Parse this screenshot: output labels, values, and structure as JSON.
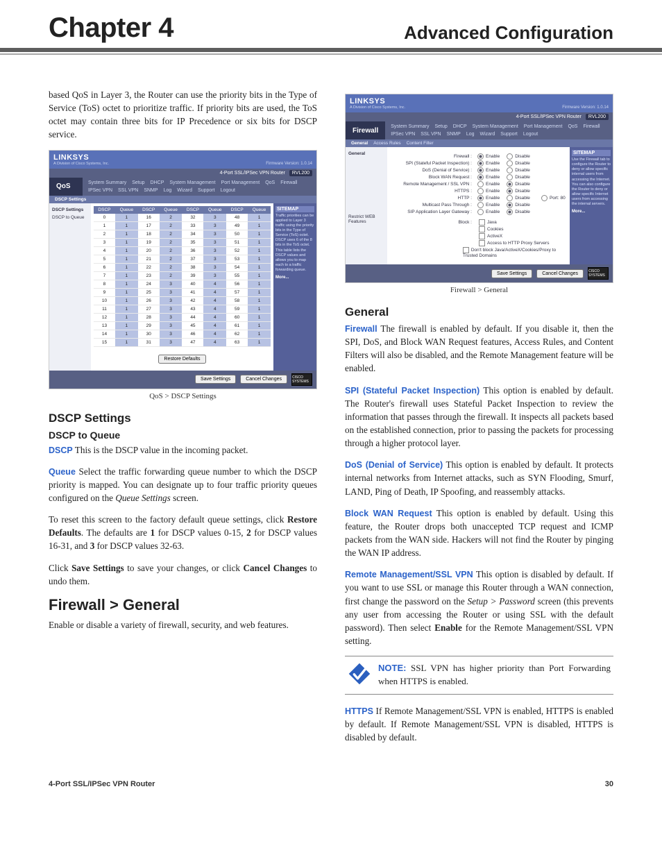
{
  "header": {
    "chapter": "Chapter 4",
    "right": "Advanced Configuration"
  },
  "col1": {
    "intro": "based QoS in Layer 3, the Router can use the priority bits in the Type of Service (ToS) octet to prioritize traffic. If priority bits are used, the ToS octet may contain three bits for IP Precedence or six bits for DSCP service.",
    "qos_ss": {
      "brand": "LINKSYS",
      "brand_sub": "A Division of Cisco Systems, Inc.",
      "fw": "Firmware Version: 1.0.14",
      "model_bar": "4-Port SSL/IPSec VPN Router",
      "model": "RVL200",
      "navlabel": "QoS",
      "navitems": [
        "System Summary",
        "Setup",
        "DHCP",
        "System Management",
        "Port Management",
        "QoS",
        "Firewall",
        "IPSec VPN",
        "SSL VPN",
        "SNMP",
        "Log",
        "Wizard",
        "Support",
        "Logout"
      ],
      "subnav_active": "DSCP Settings",
      "left_items": [
        "DSCP Settings",
        "DSCP to Queue"
      ],
      "table_headers": [
        "DSCP",
        "Queue",
        "DSCP",
        "Queue",
        "DSCP",
        "Queue",
        "DSCP",
        "Queue"
      ],
      "table_rows": [
        [
          "0",
          "1",
          "16",
          "2",
          "32",
          "3",
          "48",
          "1"
        ],
        [
          "1",
          "1",
          "17",
          "2",
          "33",
          "3",
          "49",
          "1"
        ],
        [
          "2",
          "1",
          "18",
          "2",
          "34",
          "3",
          "50",
          "1"
        ],
        [
          "3",
          "1",
          "19",
          "2",
          "35",
          "3",
          "51",
          "1"
        ],
        [
          "4",
          "1",
          "20",
          "2",
          "36",
          "3",
          "52",
          "1"
        ],
        [
          "5",
          "1",
          "21",
          "2",
          "37",
          "3",
          "53",
          "1"
        ],
        [
          "6",
          "1",
          "22",
          "2",
          "38",
          "3",
          "54",
          "1"
        ],
        [
          "7",
          "1",
          "23",
          "2",
          "39",
          "3",
          "55",
          "1"
        ],
        [
          "8",
          "1",
          "24",
          "3",
          "40",
          "4",
          "56",
          "1"
        ],
        [
          "9",
          "1",
          "25",
          "3",
          "41",
          "4",
          "57",
          "1"
        ],
        [
          "10",
          "1",
          "26",
          "3",
          "42",
          "4",
          "58",
          "1"
        ],
        [
          "11",
          "1",
          "27",
          "3",
          "43",
          "4",
          "59",
          "1"
        ],
        [
          "12",
          "1",
          "28",
          "3",
          "44",
          "4",
          "60",
          "1"
        ],
        [
          "13",
          "1",
          "29",
          "3",
          "45",
          "4",
          "61",
          "1"
        ],
        [
          "14",
          "1",
          "30",
          "3",
          "46",
          "4",
          "62",
          "1"
        ],
        [
          "15",
          "1",
          "31",
          "3",
          "47",
          "4",
          "63",
          "1"
        ]
      ],
      "restore_btn": "Restore Defaults",
      "save_btn": "Save Settings",
      "cancel_btn": "Cancel Changes",
      "sitemap": "SITEMAP",
      "sitemap_more": "More...",
      "cisco": "CISCO SYSTEMS"
    },
    "qos_caption": "QoS > DSCP Settings",
    "h_dscp": "DSCP Settings",
    "h_dscp_q": "DSCP to Queue",
    "dscp_term": "DSCP",
    "dscp_text": "  This is the DSCP value in the incoming packet.",
    "queue_term": "Queue",
    "queue_text_a": "  Select the traffic forwarding queue number to which the DSCP priority is mapped. You can designate up to four traffic priority queues configured on the ",
    "queue_text_ital": "Queue Settings",
    "queue_text_b": " screen.",
    "reset_a": "To reset this screen to the factory default queue settings, click ",
    "reset_bold": "Restore Defaults",
    "reset_b": ". The defaults are ",
    "reset_1": "1",
    "reset_c": " for DSCP values 0-15, ",
    "reset_2": "2",
    "reset_d": " for DSCP values 16-31, and ",
    "reset_3": "3",
    "reset_e": " for DSCP values 32-63.",
    "save_a": "Click ",
    "save_bold1": "Save Settings",
    "save_b": " to save your changes, or click ",
    "save_bold2": "Cancel Changes",
    "save_c": " to undo them.",
    "h_fw": "Firewall > General",
    "fw_intro": "Enable or disable a variety of firewall, security, and web features."
  },
  "col2": {
    "fw_ss": {
      "brand": "LINKSYS",
      "brand_sub": "A Division of Cisco Systems, Inc.",
      "fw": "Firmware Version: 1.0.14",
      "model_bar": "4-Port SSL/IPSec VPN Router",
      "model": "RVL200",
      "navlabel": "Firewall",
      "navitems": [
        "System Summary",
        "Setup",
        "DHCP",
        "System Management",
        "Port Management",
        "QoS",
        "Firewall",
        "IPSec VPN",
        "SSL VPN",
        "SNMP",
        "Log",
        "Wizard",
        "Support",
        "Logout"
      ],
      "subnav": [
        "General",
        "Access Rules",
        "Content Filter"
      ],
      "left_items": [
        "General",
        "",
        "Restrict WEB Features"
      ],
      "rows": [
        {
          "lbl": "Firewall :",
          "en": true
        },
        {
          "lbl": "SPI (Stateful Packet Inspection) :",
          "en": true
        },
        {
          "lbl": "DoS (Denial of Service) :",
          "en": true
        },
        {
          "lbl": "Block WAN Request :",
          "en": true
        },
        {
          "lbl": "Remote Management / SSL VPN :",
          "en": false
        },
        {
          "lbl": "HTTPS :",
          "en": false
        },
        {
          "lbl": "HTTP :",
          "en": true,
          "port": "80"
        },
        {
          "lbl": "Multicast Pass Through :",
          "en": false
        },
        {
          "lbl": "SIP Application Layer Gateway :",
          "en": false
        }
      ],
      "enable": "Enable",
      "disable": "Disable",
      "port": "Port",
      "block_label": "Block :",
      "block_items": [
        "Java",
        "Cookies",
        "ActiveX",
        "Access to HTTP Proxy Servers"
      ],
      "dont_block": "Don't block Java/ActiveX/Cookies/Proxy to Trusted Domains",
      "save_btn": "Save Settings",
      "cancel_btn": "Cancel Changes",
      "sitemap": "SITEMAP",
      "sitemap_more": "More...",
      "cisco": "CISCO SYSTEMS"
    },
    "fw_caption": "Firewall > General",
    "h_general": "General",
    "t_firewall": "Firewall",
    "p_firewall": "  The firewall is enabled by default. If you disable it, then the SPI, DoS, and Block WAN Request features, Access Rules, and Content Filters will also be disabled, and the Remote Management feature will be enabled.",
    "t_spi": "SPI (Stateful Packet Inspection)",
    "p_spi": "  This option is enabled by default. The Router's firewall uses Stateful Packet Inspection to review the information that passes through the firewall. It inspects all packets based on the established connection, prior to passing the packets for processing through a higher protocol layer.",
    "t_dos": "DoS (Denial of Service)",
    "p_dos": "   This option is enabled by default. It protects internal networks from Internet attacks, such as SYN Flooding, Smurf, LAND, Ping of Death, IP Spoofing, and reassembly attacks.",
    "t_bwr": "Block WAN Request",
    "p_bwr": "  This option is enabled by default. Using this feature, the Router drops both unaccepted TCP request and ICMP packets from the WAN side. Hackers will not find the Router by pinging the WAN IP address.",
    "t_rm": "Remote Management/SSL VPN",
    "p_rm_a": "  This option is disabled by default. If you want to use SSL or manage this Router through a WAN connection, first change the password on the ",
    "p_rm_ital": "Setup > Password",
    "p_rm_b": " screen (this prevents any user from accessing the Router or using SSL with the default password). Then select ",
    "p_rm_bold": "Enable",
    "p_rm_c": " for the Remote Management/SSL VPN setting.",
    "note_label": "NOTE:",
    "note_text": " SSL VPN has higher priority than Port Forwarding when HTTPS is enabled.",
    "t_https": "HTTPS",
    "p_https": " If Remote Management/SSL VPN is enabled, HTTPS is enabled by default. If Remote Management/SSL VPN is disabled, HTTPS is disabled by default."
  },
  "footer": {
    "left": "4-Port SSL/IPSec VPN Router",
    "right": "30"
  }
}
